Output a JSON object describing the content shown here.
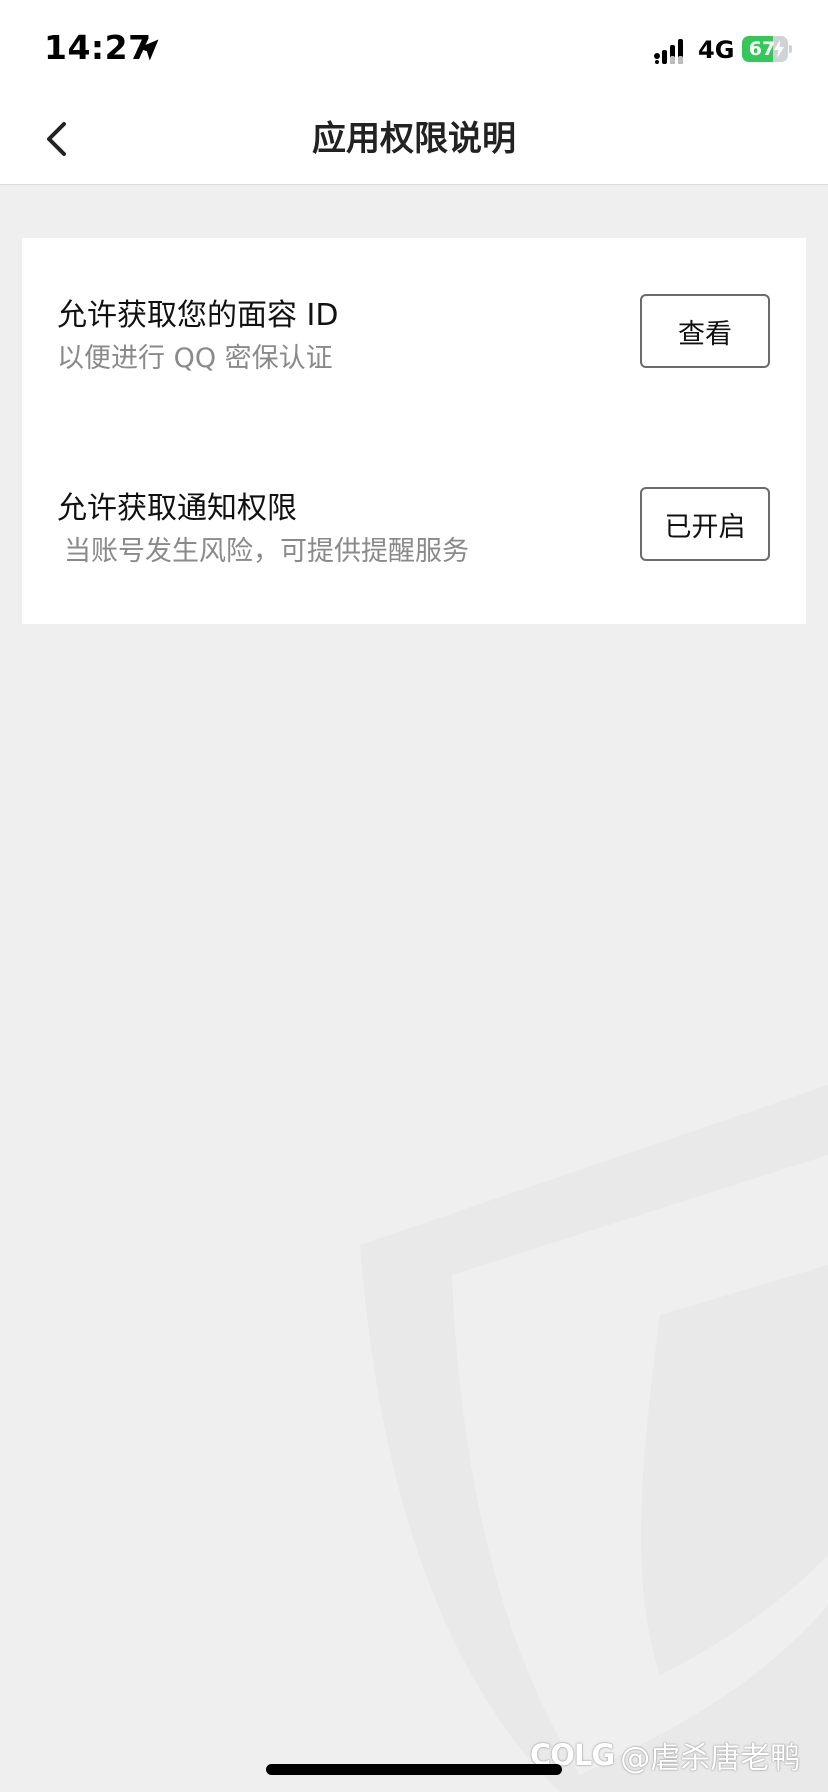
{
  "status_bar": {
    "time": "14:27",
    "network": "4G",
    "battery_level": "67",
    "battery_fraction": 0.67,
    "battery_color": "#34c759"
  },
  "nav": {
    "title": "应用权限说明",
    "back_icon": "chevron-left-icon"
  },
  "permissions": [
    {
      "title": "允许获取您的面容 ID",
      "description": "以便进行 QQ 密保认证",
      "button_label": "查看"
    },
    {
      "title": "允许获取通知权限",
      "description": "当账号发生风险，可提供提醒服务",
      "button_label": "已开启"
    }
  ],
  "watermark": {
    "logo": "COLG",
    "text": "@虐杀唐老鸭"
  },
  "colors": {
    "background": "#efefef",
    "card": "#ffffff",
    "secondary_text": "#8a8a8a"
  }
}
